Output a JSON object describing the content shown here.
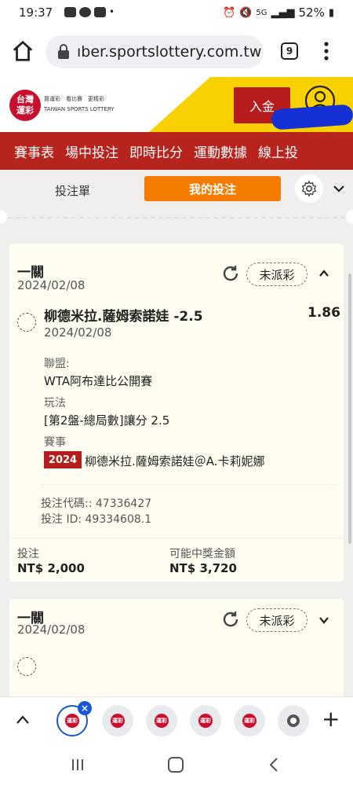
{
  "status_bar": {
    "time": "19:37",
    "battery": "52%",
    "network": "5G"
  },
  "browser": {
    "url": "ıber.sportslottery.com.tw",
    "tab_count": "9"
  },
  "site": {
    "logo_text": "台灣\n運彩",
    "logo_subtitle_line1": "買運彩　看比賽　更精彩",
    "logo_subtitle_line2": "TAIWAN SPORTS LOTTERY",
    "deposit_label": "入金"
  },
  "nav": {
    "items": [
      "賽事表",
      "場中投注",
      "即時比分",
      "運動數據",
      "線上投"
    ]
  },
  "tabs": {
    "bet_slip": "投注單",
    "my_bets": "我的投注"
  },
  "cards": [
    {
      "title": "一關",
      "date": "2024/02/08",
      "status": "未派彩",
      "selection": "柳德米拉.薩姆索諾娃 -2.5",
      "odds": "1.86",
      "selection_date": "2024/02/08",
      "league_label": "聯盟:",
      "league_value": "WTA阿布達比公開賽",
      "market_label": "玩法",
      "market_value": "[第2盤-總局數]讓分 2.5",
      "event_label": "賽事",
      "event_year": "2024",
      "event_name": "柳德米拉.薩姆索諾娃＠A.卡莉妮娜",
      "bet_code": "投注代碼:: 47336427",
      "bet_id": "投注 ID: 49334608.1",
      "stake_label": "投注",
      "stake_value": "NT$ 2,000",
      "payout_label": "可能中獎金額",
      "payout_value": "NT$ 3,720"
    },
    {
      "title": "一關",
      "date": "2024/02/08",
      "status": "未派彩"
    }
  ],
  "colors": {
    "brand_red": "#b7231d",
    "accent_orange": "#f57c00",
    "yellow": "#f9d100"
  }
}
